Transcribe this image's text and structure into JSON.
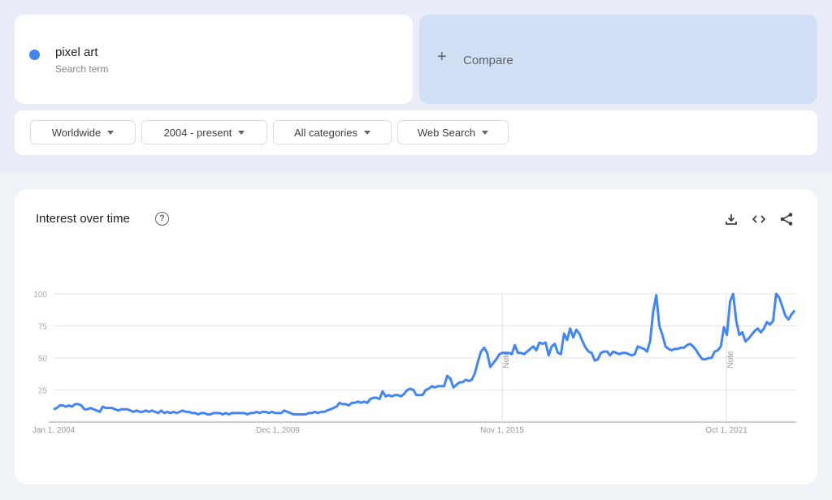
{
  "search_term": {
    "name": "pixel art",
    "subtitle": "Search term",
    "color": "#4285f4"
  },
  "compare": {
    "icon": "plus-icon",
    "label": "Compare"
  },
  "filters": [
    {
      "label": "Worldwide"
    },
    {
      "label": "2004 - present"
    },
    {
      "label": "All categories"
    },
    {
      "label": "Web Search"
    }
  ],
  "panel": {
    "title": "Interest over time",
    "help_icon": "help-circle-icon",
    "tools": [
      "download-icon",
      "embed-code-icon",
      "share-icon"
    ]
  },
  "chart_data": {
    "type": "line",
    "title": "Interest over time",
    "xlabel": "",
    "ylabel": "",
    "ylim": [
      0,
      100
    ],
    "y_ticks": [
      25,
      50,
      75,
      100
    ],
    "x_tick_labels": [
      "Jan 1, 2004",
      "Dec 1, 2009",
      "Nov 1, 2015",
      "Oct 1, 2021"
    ],
    "x_tick_months": [
      0,
      71,
      142,
      213
    ],
    "notes": [
      {
        "label": "Note",
        "month": 142
      },
      {
        "label": "Note",
        "month": 213
      }
    ],
    "grid": true,
    "series": [
      {
        "name": "pixel art",
        "color": "#4285f4",
        "start": "Jan 2004",
        "frequency": "monthly",
        "values": [
          10,
          11,
          13,
          13,
          12,
          13,
          12,
          14,
          14,
          13,
          10,
          10,
          11,
          10,
          9,
          8,
          12,
          11,
          11,
          11,
          10,
          9,
          10,
          10,
          10,
          9,
          8,
          9,
          8,
          8,
          9,
          8,
          9,
          8,
          7,
          9,
          7,
          8,
          7,
          8,
          7,
          8,
          9,
          8,
          8,
          7,
          7,
          6,
          7,
          7,
          6,
          6,
          7,
          7,
          7,
          6,
          7,
          6,
          7,
          7,
          7,
          7,
          7,
          6,
          7,
          7,
          8,
          7,
          8,
          8,
          7,
          8,
          7,
          7,
          7,
          9,
          8,
          7,
          6,
          6,
          6,
          6,
          6,
          7,
          7,
          8,
          7,
          8,
          8,
          9,
          10,
          11,
          12,
          15,
          14,
          14,
          13,
          15,
          15,
          16,
          15,
          16,
          15,
          18,
          19,
          19,
          18,
          24,
          20,
          21,
          20,
          21,
          21,
          20,
          22,
          25,
          26,
          25,
          21,
          21,
          21,
          25,
          26,
          28,
          27,
          28,
          28,
          28,
          36,
          34,
          27,
          29,
          31,
          31,
          33,
          32,
          33,
          38,
          47,
          55,
          58,
          54,
          43,
          46,
          49,
          53,
          54,
          54,
          54,
          53,
          60,
          54,
          54,
          53,
          55,
          57,
          59,
          56,
          62,
          61,
          62,
          52,
          59,
          61,
          54,
          53,
          69,
          64,
          73,
          66,
          72,
          69,
          63,
          58,
          55,
          54,
          48,
          49,
          54,
          55,
          55,
          52,
          55,
          54,
          53,
          54,
          54,
          53,
          52,
          53,
          59,
          58,
          57,
          55,
          63,
          86,
          99,
          75,
          68,
          59,
          57,
          56,
          57,
          57,
          58,
          58,
          60,
          61,
          59,
          56,
          52,
          49,
          49,
          50,
          50,
          55,
          56,
          59,
          74,
          68,
          94,
          100,
          79,
          68,
          70,
          63,
          65,
          68,
          71,
          73,
          70,
          73,
          78,
          76,
          79,
          100,
          97,
          90,
          83,
          80,
          84,
          87
        ]
      }
    ]
  }
}
